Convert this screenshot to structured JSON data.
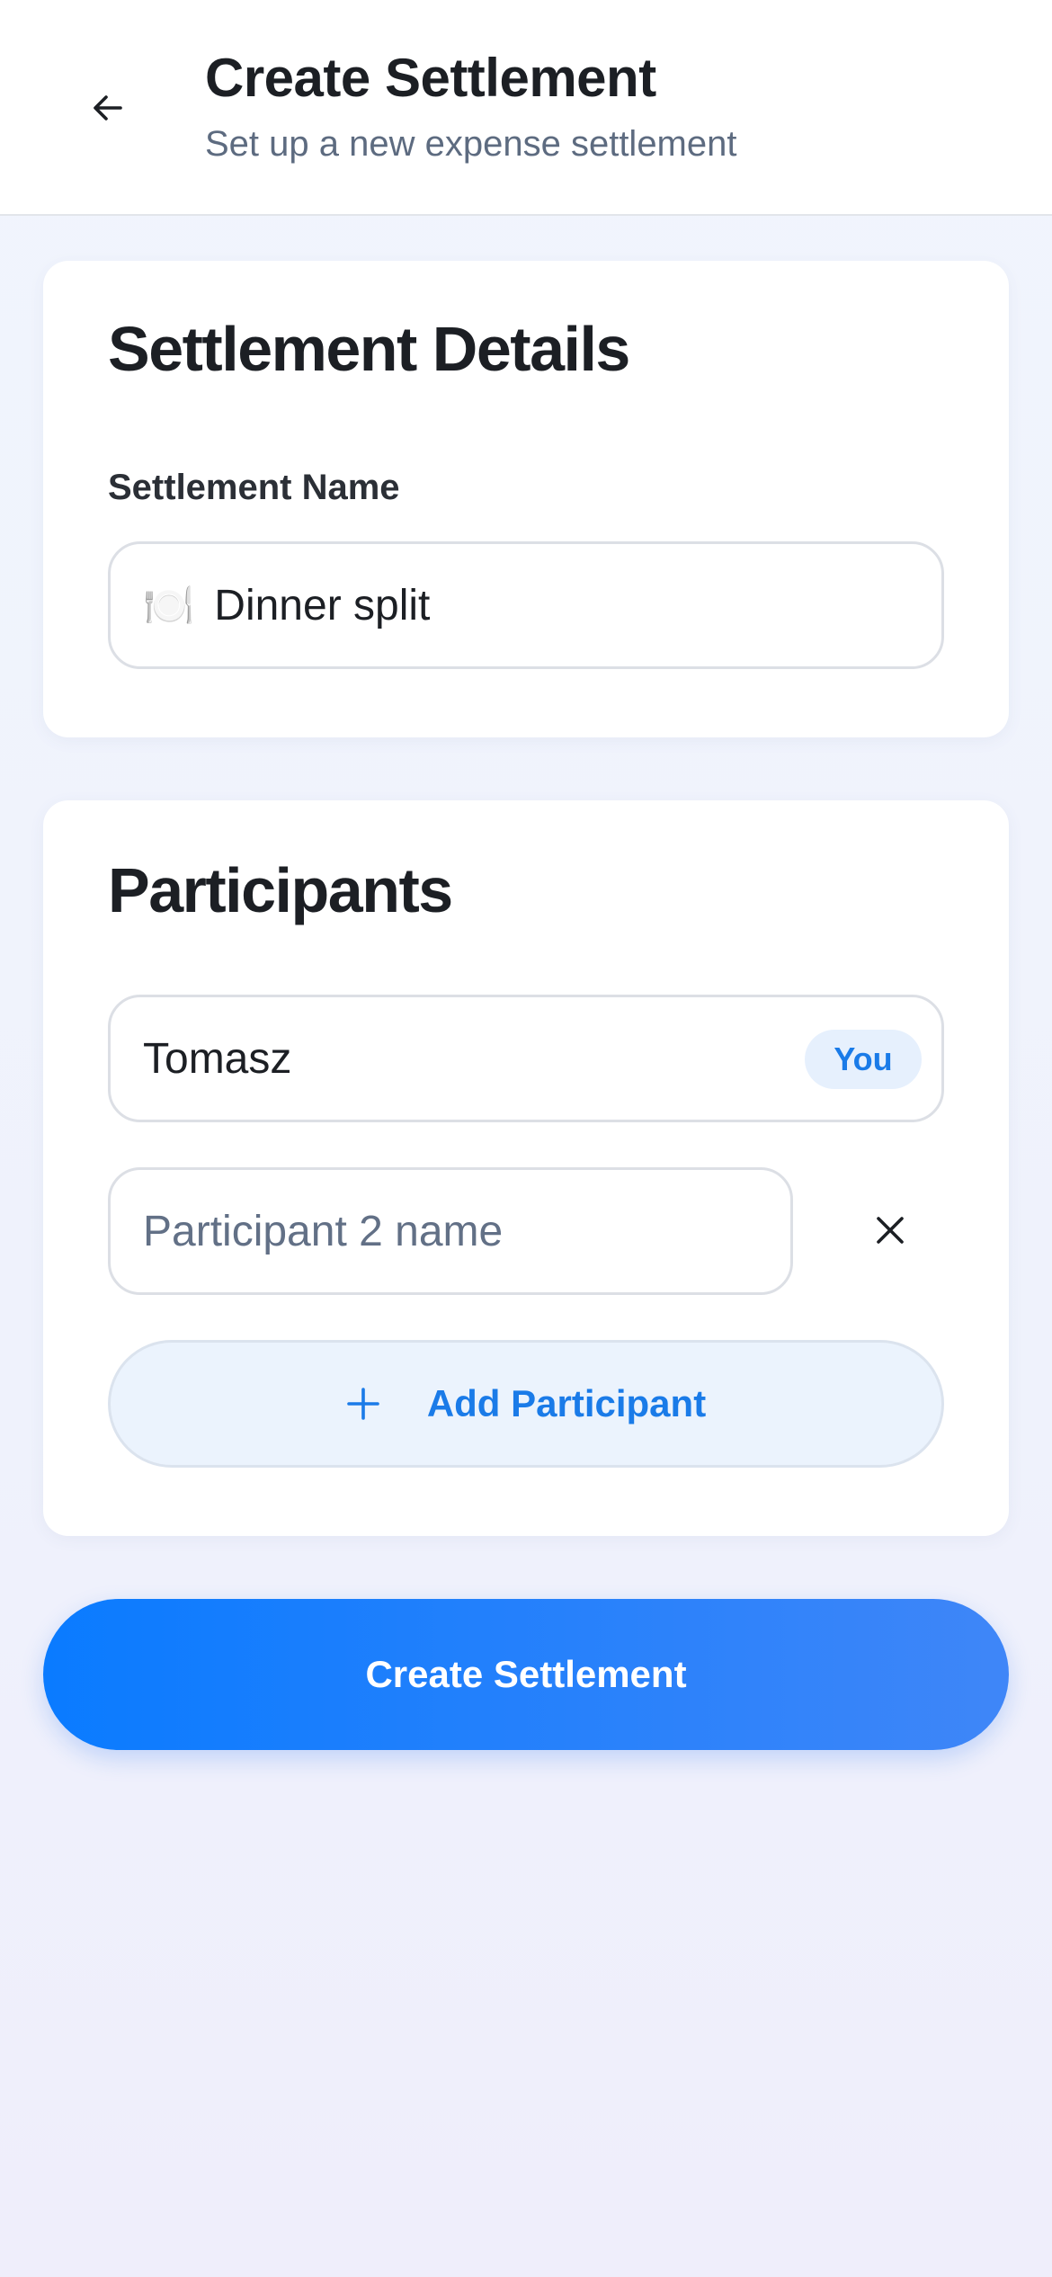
{
  "header": {
    "title": "Create Settlement",
    "subtitle": "Set up a new expense settlement",
    "back_icon": "arrow-left-icon"
  },
  "details": {
    "title": "Settlement Details",
    "name_label": "Settlement Name",
    "name_emoji": "🍽️",
    "name_value": "Dinner split"
  },
  "participants": {
    "title": "Participants",
    "items": [
      {
        "name": "Tomasz",
        "badge": "You"
      },
      {
        "placeholder": "Participant 2 name",
        "remove_icon": "close-icon"
      }
    ],
    "add_label": "Add Participant",
    "add_icon": "plus-icon"
  },
  "actions": {
    "create_label": "Create Settlement"
  },
  "colors": {
    "accent": "#1a7be8",
    "button_gradient_start": "#0a7bff",
    "button_gradient_end": "#3f86f8",
    "background": "#f1f5fd"
  }
}
